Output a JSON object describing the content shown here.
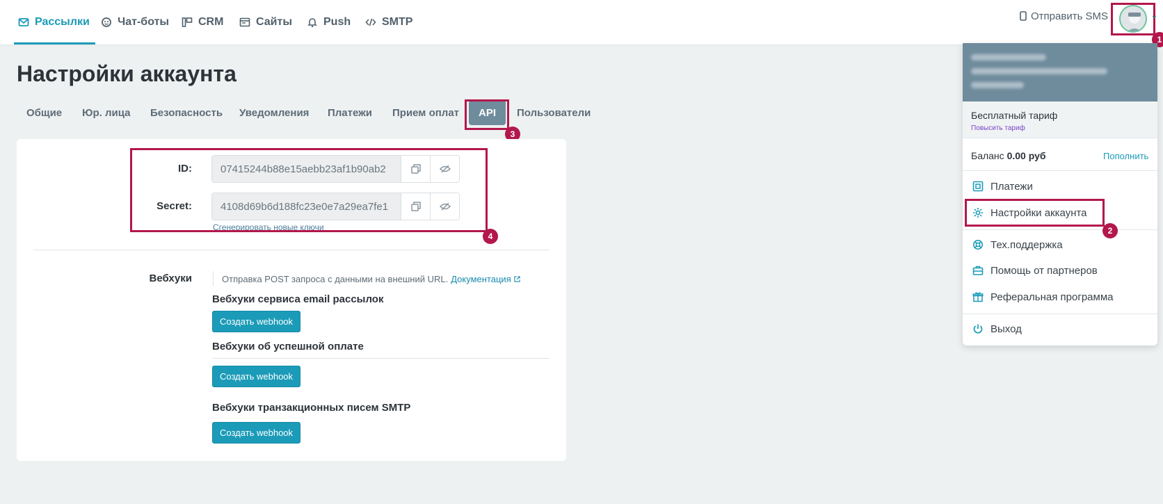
{
  "colors": {
    "accent": "#1b9bb8",
    "highlight": "#b3174b",
    "tab_active": "#6f8c9d"
  },
  "nav": {
    "items": [
      {
        "label": "Рассылки",
        "icon": "envelope-icon",
        "active": true
      },
      {
        "label": "Чат-боты",
        "icon": "chat-bot-icon"
      },
      {
        "label": "CRM",
        "icon": "crm-icon"
      },
      {
        "label": "Сайты",
        "icon": "website-icon"
      },
      {
        "label": "Push",
        "icon": "bell-icon"
      },
      {
        "label": "SMTP",
        "icon": "code-icon"
      }
    ],
    "send_sms": "Отправить SMS"
  },
  "page": {
    "title": "Настройки аккаунта",
    "tabs": [
      "Общие",
      "Юр. лица",
      "Безопасность",
      "Уведомления",
      "Платежи",
      "Прием оплат",
      "API",
      "Пользователи"
    ],
    "active_tab": "API"
  },
  "api": {
    "id_label": "ID:",
    "id_value": "07415244b88e15aebb23af1b90ab2",
    "secret_label": "Secret:",
    "secret_value": "4108d69b6d188fc23e0e7a29ea7fe1",
    "regen_link": "Сгенерировать новые ключи"
  },
  "webhooks": {
    "label": "Вебхуки",
    "description": "Отправка POST запроса с данными на внешний URL.",
    "doc_link": "Документация",
    "sections": [
      {
        "title": "Вебхуки сервиса email рассылок",
        "button": "Создать webhook"
      },
      {
        "title": "Вебхуки об успешной оплате",
        "button": "Создать webhook"
      },
      {
        "title": "Вебхуки транзакционных писем SMTP",
        "button": "Создать webhook"
      }
    ]
  },
  "dropdown": {
    "plan": "Бесплатный тариф",
    "upgrade": "Повысить тариф",
    "balance_label": "Баланс",
    "balance_value": "0.00 руб",
    "topup": "Пополнить",
    "items": [
      {
        "label": "Платежи",
        "icon": "payments-icon"
      },
      {
        "label": "Настройки аккаунта",
        "icon": "gear-icon"
      },
      {
        "label": "Тех.поддержка",
        "icon": "lifebuoy-icon"
      },
      {
        "label": "Помощь от партнеров",
        "icon": "briefcase-icon"
      },
      {
        "label": "Реферальная программа",
        "icon": "gift-icon"
      },
      {
        "label": "Выход",
        "icon": "power-icon"
      }
    ]
  },
  "annotations": [
    "1",
    "2",
    "3",
    "4"
  ]
}
